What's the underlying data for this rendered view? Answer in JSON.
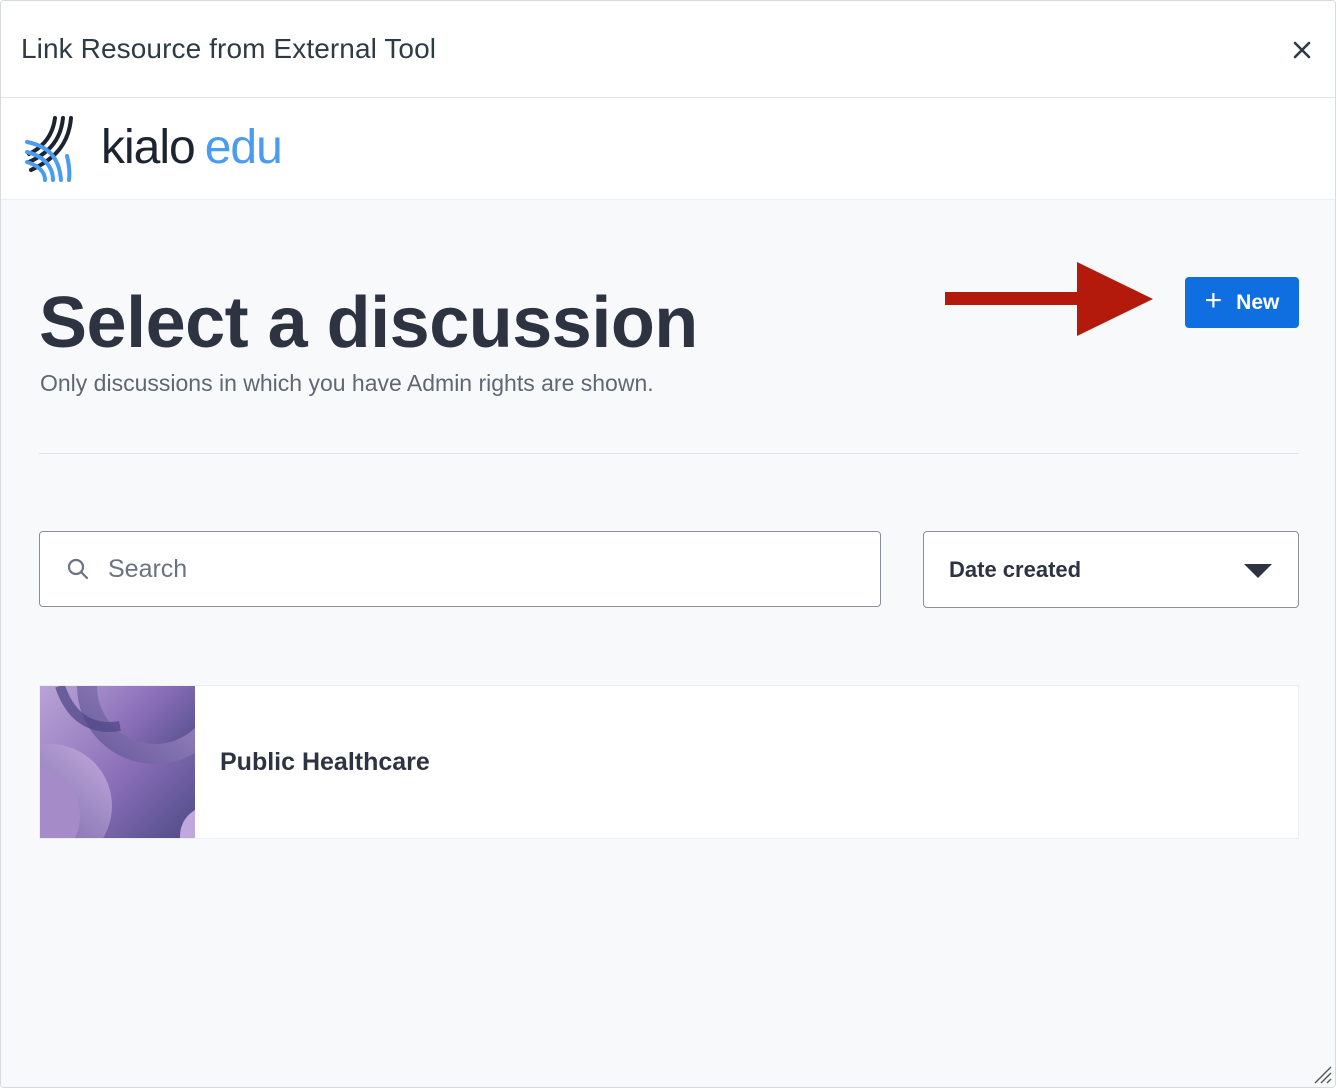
{
  "dialog": {
    "title": "Link Resource from External Tool",
    "close_icon": "close-icon"
  },
  "brand": {
    "word1": "kialo",
    "word2": "edu",
    "accent_color": "#4a9cf0"
  },
  "page": {
    "title": "Select a discussion",
    "subtitle": "Only discussions in which you have Admin rights are shown.",
    "new_button": {
      "icon": "+",
      "label": "New"
    },
    "annotation_arrow_color": "#b31a0c"
  },
  "search": {
    "placeholder": "Search",
    "value": ""
  },
  "sort": {
    "selected": "Date created"
  },
  "discussions": [
    {
      "title": "Public Healthcare"
    }
  ],
  "colors": {
    "primary": "#0f6ee0",
    "text_dark": "#2d3340",
    "text_muted": "#5e6773",
    "background": "#f8f9fb"
  }
}
